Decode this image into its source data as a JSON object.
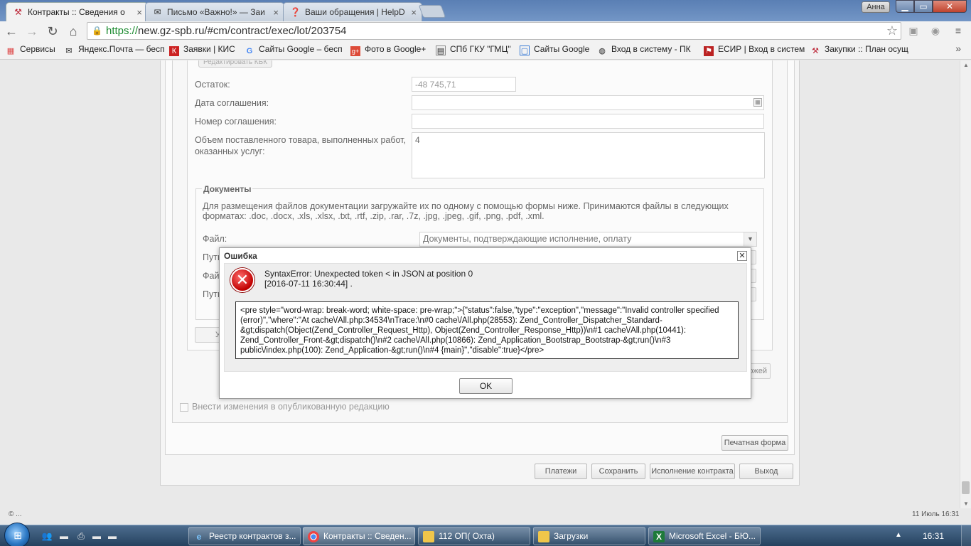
{
  "browser": {
    "tabs": [
      {
        "title": "Контракты :: Сведения о"
      },
      {
        "title": "Письмо «Важно!» — Заи"
      },
      {
        "title": "Ваши обращения | HelpD"
      }
    ],
    "user": "Анна",
    "url_scheme": "https://",
    "url_rest": "new.gz-spb.ru/#cm/contract/exec/lot/203754",
    "bookmarks": [
      {
        "label": "Сервисы",
        "icon": "apps-grid-icon"
      },
      {
        "label": "Яндекс.Почта — бесп",
        "icon": "mail-icon"
      },
      {
        "label": "Заявки | КИС",
        "icon": "kis-icon"
      },
      {
        "label": "Сайты Google – бесп",
        "icon": "google-icon"
      },
      {
        "label": "Фото в Google+",
        "icon": "google-plus-icon"
      },
      {
        "label": "СПб ГКУ \"ГМЦ\"",
        "icon": "gmc-icon"
      },
      {
        "label": "Сайты Google",
        "icon": "google-sites-icon"
      },
      {
        "label": "Вход в систему - ПК",
        "icon": "login-icon"
      },
      {
        "label": "ЕСИР | Вход в систем",
        "icon": "esir-icon"
      },
      {
        "label": "Закупки :: План осущ",
        "icon": "purchases-icon"
      }
    ]
  },
  "form": {
    "cut_button": "Редактировать КБК",
    "remainder_label": "Остаток:",
    "remainder_value": "-48 745,71",
    "agreement_date_label": "Дата соглашения:",
    "agreement_number_label": "Номер соглашения:",
    "volume_label": "Объем поставленного товара, выполненных работ, оказанных услуг:",
    "volume_value": "4",
    "docs_legend": "Документы",
    "docs_help": "Для размещения файлов документации загружайте их по одному с помощью формы ниже. Принимаются файлы в следующих форматах: .doc, .docx, .xls, .xlsx, .txt, .rtf, .zip, .rar, .7z, .jpg, .jpeg, .gif, .png, .pdf, .xml.",
    "file_label": "Файл:",
    "file_select": "Документы, подтверждающие исполнение, оплату",
    "path_label_1": "Путь",
    "file_label_2": "Файл",
    "path_label_2": "Путь",
    "partial_btn": "У",
    "partial_btn_right": "ожей",
    "checkbox_label": "Внести изменения в опубликованную редакцию",
    "print_button": "Печатная форма",
    "bottom_buttons": [
      "Платежи",
      "Сохранить",
      "Исполнение контракта",
      "Выход"
    ]
  },
  "dialog": {
    "title": "Ошибка",
    "message_line1": "SyntaxError: Unexpected token < in JSON at position 0",
    "message_line2": "[2016-07-11 16:30:44] .",
    "details": "<pre style=\"word-wrap: break-word; white-space: pre-wrap;\">{\"status\":false,\"type\":\"exception\",\"message\":\"Invalid controller specified (error)\",\"where\":\"At cache\\/All.php:34534\\nTrace:\\n#0 cache\\/All.php(28553): Zend_Controller_Dispatcher_Standard-&gt;dispatch(Object(Zend_Controller_Request_Http), Object(Zend_Controller_Response_Http))\\n#1 cache\\/All.php(10441): Zend_Controller_Front-&gt;dispatch()\\n#2 cache\\/All.php(10866): Zend_Application_Bootstrap_Bootstrap-&gt;run()\\n#3 public\\/index.php(100): Zend_Application-&gt;run()\\n#4 {main}\",\"disable\":true}</pre>",
    "ok": "OK"
  },
  "statusbar": {
    "left": "© ...",
    "right": "11 Июль 16:31"
  },
  "taskbar": {
    "windows": [
      {
        "label": "Реестр контрактов з...",
        "icon": "ie-icon"
      },
      {
        "label": "Контракты :: Сведен...",
        "icon": "chrome-icon"
      },
      {
        "label": "112 ОП( Охта)",
        "icon": "folder-icon"
      },
      {
        "label": "Загрузки",
        "icon": "folder-icon"
      },
      {
        "label": "Microsoft Excel - БЮ...",
        "icon": "excel-icon"
      }
    ],
    "clock": "16:31"
  },
  "colors": {
    "accent": "#5a7fb4",
    "https": "#1a8a2e",
    "error": "#c00000"
  }
}
